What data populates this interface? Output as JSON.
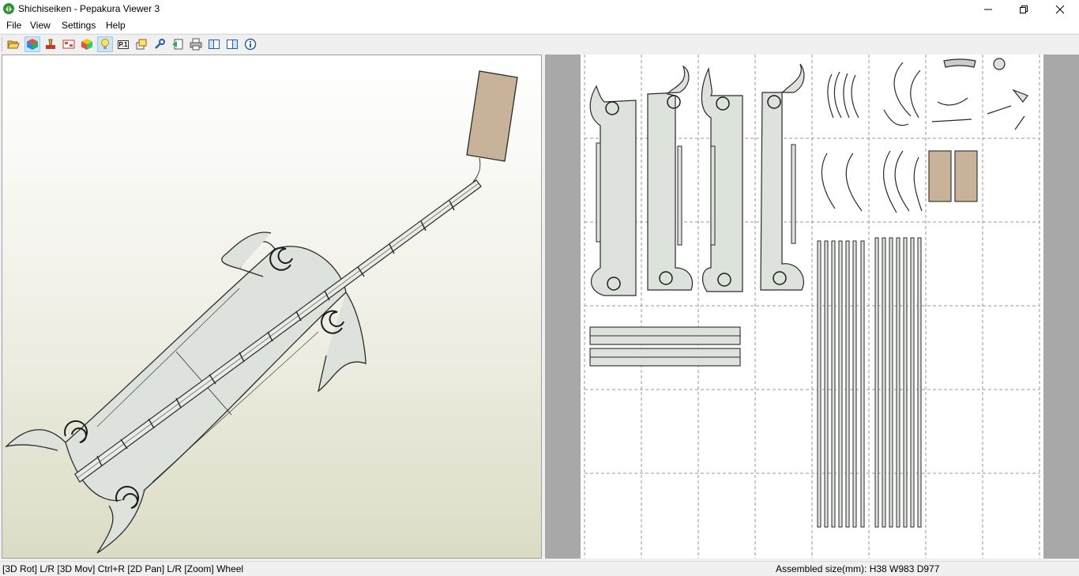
{
  "window": {
    "title": "Shichiseiken - Pepakura Viewer 3",
    "minimize_icon": "minimize-icon",
    "maximize_icon": "restore-icon",
    "close_icon": "close-icon"
  },
  "menu": {
    "items": [
      {
        "label": "File"
      },
      {
        "label": "View"
      },
      {
        "label": "Settings"
      },
      {
        "label": "Help"
      }
    ]
  },
  "toolbar": {
    "buttons": [
      {
        "icon": "open-folder-icon"
      },
      {
        "icon": "3d-cube-icon",
        "active": true
      },
      {
        "icon": "texture-icon"
      },
      {
        "icon": "flaps-icon"
      },
      {
        "icon": "color-cube-icon"
      },
      {
        "icon": "light-bulb-icon",
        "active": true
      },
      {
        "icon": "page-number-icon",
        "label": "P.1"
      },
      {
        "icon": "cut-lines-icon"
      },
      {
        "icon": "wrench-icon"
      },
      {
        "icon": "export-icon"
      },
      {
        "icon": "print-icon"
      },
      {
        "icon": "left-pane-icon"
      },
      {
        "icon": "right-pane-icon"
      },
      {
        "icon": "info-icon"
      }
    ]
  },
  "colors": {
    "part_fill": "#dde2dc",
    "part_stroke": "#2a2a2a",
    "handle_fill": "#c8b39a",
    "pane_gray": "#a8a8a8"
  },
  "status": {
    "left": "[3D Rot] L/R [3D Mov] Ctrl+R [2D Pan] L/R [Zoom] Wheel",
    "right": "Assembled size(mm): H38 W983 D977"
  }
}
